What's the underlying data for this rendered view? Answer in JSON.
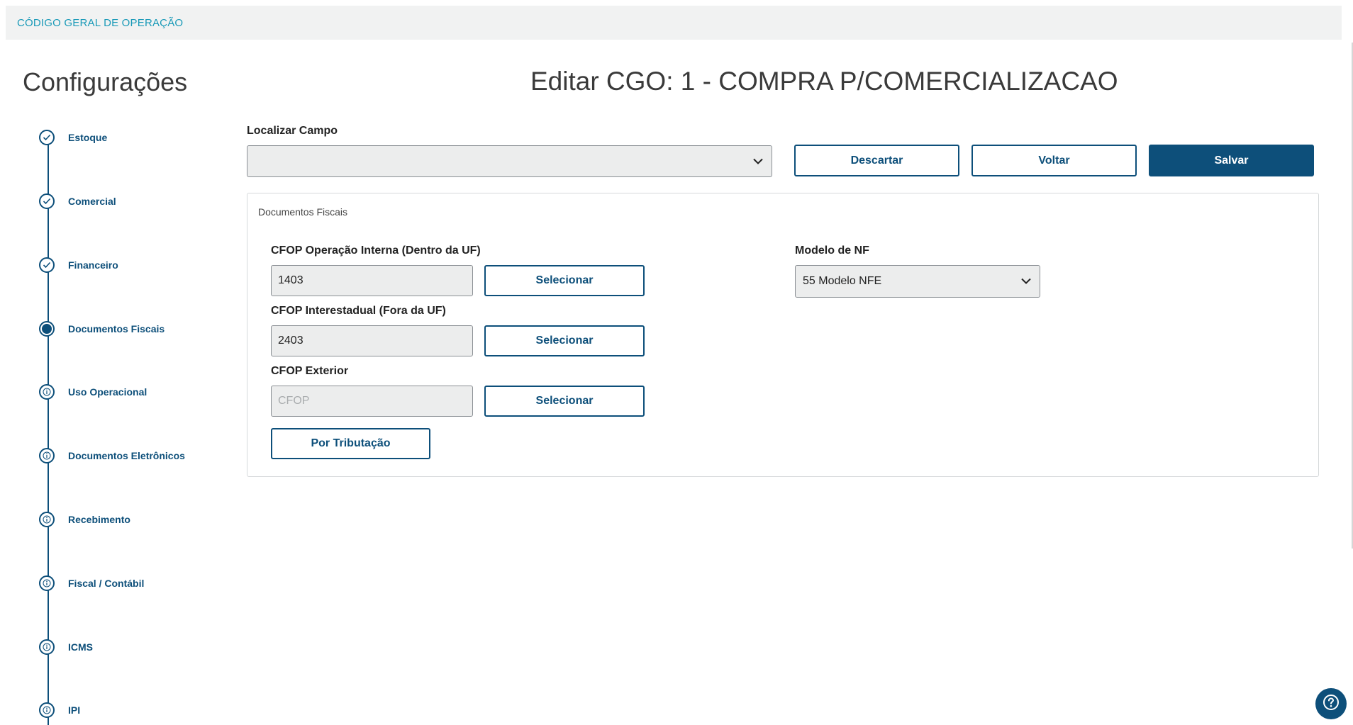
{
  "header": {
    "title": "CÓDIGO GERAL DE OPERAÇÃO"
  },
  "sidebar": {
    "title": "Configurações",
    "steps": [
      {
        "label": "Estoque",
        "state": "done"
      },
      {
        "label": "Comercial",
        "state": "done"
      },
      {
        "label": "Financeiro",
        "state": "done"
      },
      {
        "label": "Documentos Fiscais",
        "state": "active"
      },
      {
        "label": "Uso Operacional",
        "state": "info"
      },
      {
        "label": "Documentos Eletrônicos",
        "state": "info"
      },
      {
        "label": "Recebimento",
        "state": "info"
      },
      {
        "label": "Fiscal / Contábil",
        "state": "info"
      },
      {
        "label": "ICMS",
        "state": "info"
      },
      {
        "label": "IPI",
        "state": "info"
      }
    ]
  },
  "main": {
    "title": "Editar CGO: 1 - COMPRA P/COMERCIALIZACAO",
    "search": {
      "label": "Localizar Campo",
      "value": ""
    },
    "actions": {
      "discard": "Descartar",
      "back": "Voltar",
      "save": "Salvar"
    },
    "panel": {
      "title": "Documentos Fiscais",
      "cfop_interna": {
        "label": "CFOP Operação Interna (Dentro da UF)",
        "value": "1403",
        "button": "Selecionar"
      },
      "cfop_interestadual": {
        "label": "CFOP Interestadual (Fora da UF)",
        "value": "2403",
        "button": "Selecionar"
      },
      "cfop_exterior": {
        "label": "CFOP Exterior",
        "value": "",
        "placeholder": "CFOP",
        "button": "Selecionar"
      },
      "por_tributacao": "Por Tributação",
      "modelo_nf": {
        "label": "Modelo de NF",
        "value": "55 Modelo NFE"
      }
    }
  },
  "colors": {
    "primary": "#0d4f7a",
    "header_text": "#1a9ab8",
    "input_bg": "#eceded"
  },
  "icons": {
    "step_done": "check-circle-icon",
    "step_active": "filled-circle-icon",
    "step_info": "info-circle-icon",
    "dropdown": "chevron-down-icon",
    "help": "help-icon"
  }
}
